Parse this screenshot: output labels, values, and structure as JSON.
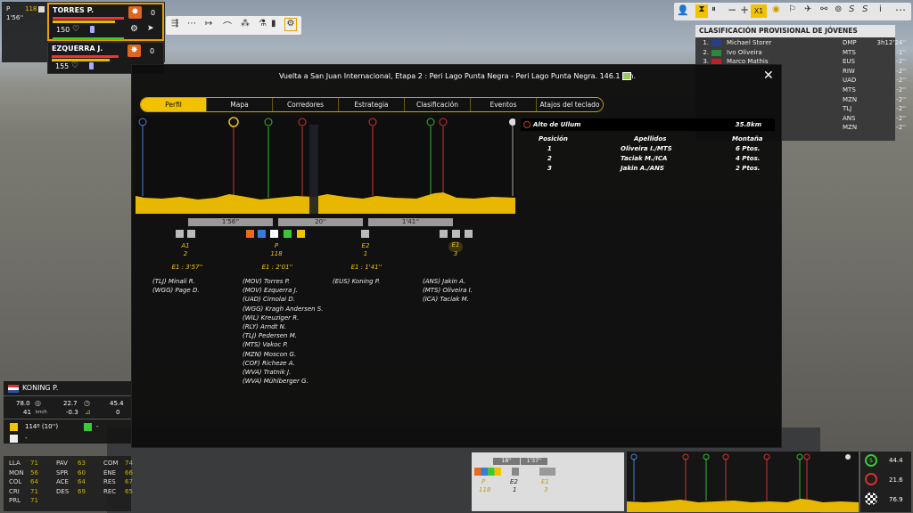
{
  "header": {
    "stage_title": "Vuelta a San Juan Internacional, Etapa 2 : Peri Lago Punta Negra - Peri Lago Punta Negra. 146.1 km.",
    "close_label": "✕"
  },
  "tabs": [
    {
      "label": "Perfil"
    },
    {
      "label": "Mapa"
    },
    {
      "label": "Corredores"
    },
    {
      "label": "Estrategia"
    },
    {
      "label": "Clasificación"
    },
    {
      "label": "Eventos"
    },
    {
      "label": "Atajos del teclado"
    }
  ],
  "team_panel": {
    "group_label": "P",
    "group_count": "118",
    "group_gap": "1'56''",
    "riders": [
      {
        "name": "TORRES P.",
        "effort": "150",
        "counter": "0"
      },
      {
        "name": "EZQUERRA J.",
        "effort": "155",
        "counter": "0"
      }
    ]
  },
  "top_right": {
    "speed": "X1"
  },
  "youth_classification": {
    "title": "CLASIFICACIÓN PROVISIONAL DE JÓVENES",
    "rows": [
      {
        "pos": "1.",
        "name": "Michael Storer",
        "team": "DMP",
        "time": "3h12'24''"
      },
      {
        "pos": "2.",
        "name": "Ivo Oliveira",
        "team": "MTS",
        "time": "-1''"
      },
      {
        "pos": "3.",
        "name": "Marco Mathis",
        "team": "EUS",
        "time": "-2''"
      },
      {
        "pos": "",
        "name": "",
        "team": "RIW",
        "time": "-2''"
      },
      {
        "pos": "",
        "name": "",
        "team": "UAD",
        "time": "-2''"
      },
      {
        "pos": "",
        "name": "",
        "team": "MTS",
        "time": "-2''"
      },
      {
        "pos": "",
        "name": "",
        "team": "MZN",
        "time": "-2''"
      },
      {
        "pos": "",
        "name": "",
        "team": "TLJ",
        "time": "-2''"
      },
      {
        "pos": "",
        "name": "",
        "team": "ANS",
        "time": "-2''"
      },
      {
        "pos": "",
        "name": "",
        "team": "MZN",
        "time": "-2''"
      }
    ]
  },
  "groups": [
    {
      "label": "A1",
      "count": "2",
      "gap": "E1 : 3'57''",
      "riders": [
        "(TLJ) Minali R.",
        "(WGG) Page D."
      ]
    },
    {
      "label": "P",
      "count": "118",
      "gap": "E1 : 2'01''",
      "riders": [
        "(MOV) Torres P.",
        "(MOV) Ezquerra J.",
        "(UAD) Cimolai D.",
        "(WGG) Kragh Andersen S.",
        "(WIL) Kreuziger R.",
        "(RLY) Arndt N.",
        "(TLJ) Pedersen M.",
        "(MTS) Vakoc P.",
        "(MZN) Moscon G.",
        "(COF) Richeze A.",
        "(WVA) Tratnik J.",
        "(WVA) Mühlberger G."
      ]
    },
    {
      "label": "E2",
      "count": "1",
      "gap": "E1 : 1'41''",
      "riders": [
        "(EUS) Koning P."
      ]
    },
    {
      "label": "E1",
      "count": "3",
      "gap": "",
      "riders": [
        "(ANS) Jakin A.",
        "(MTS) Oliveira I.",
        "(ICA) Taciak M."
      ]
    }
  ],
  "gap_bars": [
    "1'56''",
    "20''",
    "1'41''"
  ],
  "climb": {
    "name": "Alto de Ullum",
    "distance": "35.8km",
    "headers": {
      "pos": "Posición",
      "name": "Apellidos",
      "pts": "Montaña"
    },
    "rows": [
      {
        "pos": "1",
        "name": "Oliveira I./MTS",
        "pts": "6 Ptos."
      },
      {
        "pos": "2",
        "name": "Taciak M./ICA",
        "pts": "4 Ptos."
      },
      {
        "pos": "3",
        "name": "Jakin A./ANS",
        "pts": "2 Ptos."
      }
    ]
  },
  "rider_card": {
    "name": "KONING P.",
    "v1": "78.0",
    "v2": "22.7",
    "v3": "45.4",
    "v4": "41",
    "unit_kmh": "km/h",
    "v5": "-0.3",
    "v6": "0",
    "rank": "114º (10'')",
    "rank2": "-",
    "rank3": "-",
    "stats": [
      {
        "k": "LLA",
        "v": "71"
      },
      {
        "k": "PAV",
        "v": "63"
      },
      {
        "k": "COM",
        "v": "74"
      },
      {
        "k": "MON",
        "v": "56"
      },
      {
        "k": "SPR",
        "v": "60"
      },
      {
        "k": "ENE",
        "v": "66"
      },
      {
        "k": "COL",
        "v": "64"
      },
      {
        "k": "ACE",
        "v": "64"
      },
      {
        "k": "RES",
        "v": "67"
      },
      {
        "k": "CRI",
        "v": "71"
      },
      {
        "k": "DES",
        "v": "69"
      },
      {
        "k": "REC",
        "v": "65"
      },
      {
        "k": "PRL",
        "v": "71"
      }
    ]
  },
  "mini_groups": {
    "gaps": [
      "18''",
      "1'37''"
    ],
    "labels": [
      {
        "l": "P",
        "c": "118"
      },
      {
        "l": "E2",
        "c": "1"
      },
      {
        "l": "E1",
        "c": "3"
      }
    ]
  },
  "right_stats": {
    "a": "44.4",
    "b": "21.6",
    "c": "76.9"
  },
  "colors": {
    "accent": "#f2c200",
    "profile": "#e8b800"
  }
}
